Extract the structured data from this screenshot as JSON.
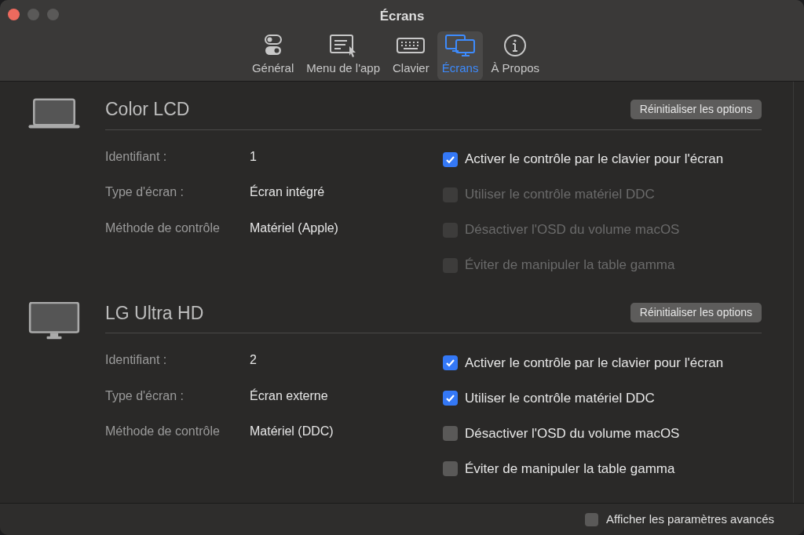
{
  "window": {
    "title": "Écrans"
  },
  "tabs": [
    {
      "label": "Général",
      "kind": "toggles",
      "selected": false
    },
    {
      "label": "Menu de l'app",
      "kind": "menu",
      "selected": false
    },
    {
      "label": "Clavier",
      "kind": "keyboard",
      "selected": false
    },
    {
      "label": "Écrans",
      "kind": "displays",
      "selected": true
    },
    {
      "label": "À Propos",
      "kind": "info",
      "selected": false
    }
  ],
  "displays": [
    {
      "name": "Color LCD",
      "kind": "laptop",
      "reset_button": "Réinitialiser les options",
      "info": [
        {
          "label": "Identifiant :",
          "value": "1"
        },
        {
          "label": "Type d'écran :",
          "value": "Écran intégré"
        },
        {
          "label": "Méthode de contrôle",
          "value": "Matériel (Apple)"
        }
      ],
      "options": [
        {
          "label": "Activer le contrôle par le clavier pour l'écran",
          "checked": true,
          "disabled": false
        },
        {
          "label": "Utiliser le contrôle matériel DDC",
          "checked": false,
          "disabled": true
        },
        {
          "label": "Désactiver l'OSD du volume macOS",
          "checked": false,
          "disabled": true
        },
        {
          "label": "Éviter de manipuler la table gamma",
          "checked": false,
          "disabled": true
        }
      ]
    },
    {
      "name": "LG Ultra HD",
      "kind": "monitor",
      "reset_button": "Réinitialiser les options",
      "info": [
        {
          "label": "Identifiant :",
          "value": "2"
        },
        {
          "label": "Type d'écran :",
          "value": "Écran externe"
        },
        {
          "label": "Méthode de contrôle",
          "value": "Matériel (DDC)"
        }
      ],
      "options": [
        {
          "label": "Activer le contrôle par le clavier pour l'écran",
          "checked": true,
          "disabled": false
        },
        {
          "label": "Utiliser le contrôle matériel DDC",
          "checked": true,
          "disabled": false
        },
        {
          "label": "Désactiver l'OSD du volume macOS",
          "checked": false,
          "disabled": false
        },
        {
          "label": "Éviter de manipuler la table gamma",
          "checked": false,
          "disabled": false
        }
      ]
    }
  ],
  "footer": {
    "label": "Afficher les paramètres avancés",
    "checked": false
  }
}
